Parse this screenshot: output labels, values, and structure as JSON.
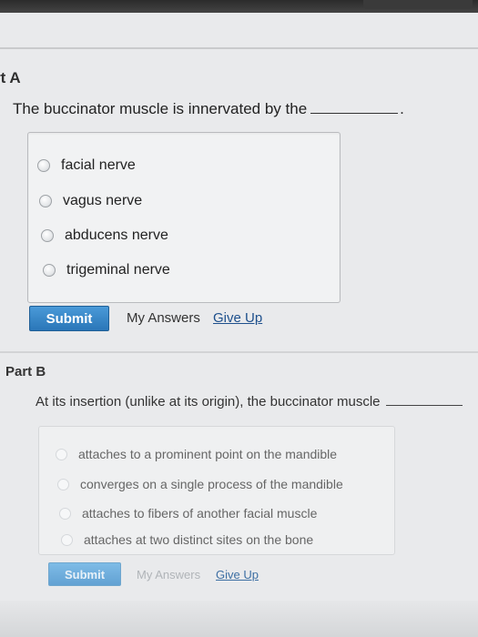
{
  "part_a": {
    "title": "rt A",
    "question": "The buccinator muscle is innervated by the",
    "end_punct": ".",
    "options": [
      "facial nerve",
      "vagus nerve",
      "abducens nerve",
      "trigeminal nerve"
    ],
    "submit_label": "Submit",
    "my_answers_label": "My Answers",
    "give_up_label": "Give Up"
  },
  "part_b": {
    "title": "Part B",
    "question": "At its insertion (unlike at its origin), the buccinator muscle",
    "options": [
      "attaches to a prominent point on the mandible",
      "converges on a single process of the mandible",
      "attaches to fibers of another facial muscle",
      "attaches at two distinct sites on the bone"
    ],
    "submit_label": "Submit",
    "my_answers_label": "My Answers",
    "give_up_label": "Give Up"
  },
  "colors": {
    "submit_button": "#2a76b8",
    "link": "#1d4f8c",
    "page_background": "#e9eaec"
  }
}
